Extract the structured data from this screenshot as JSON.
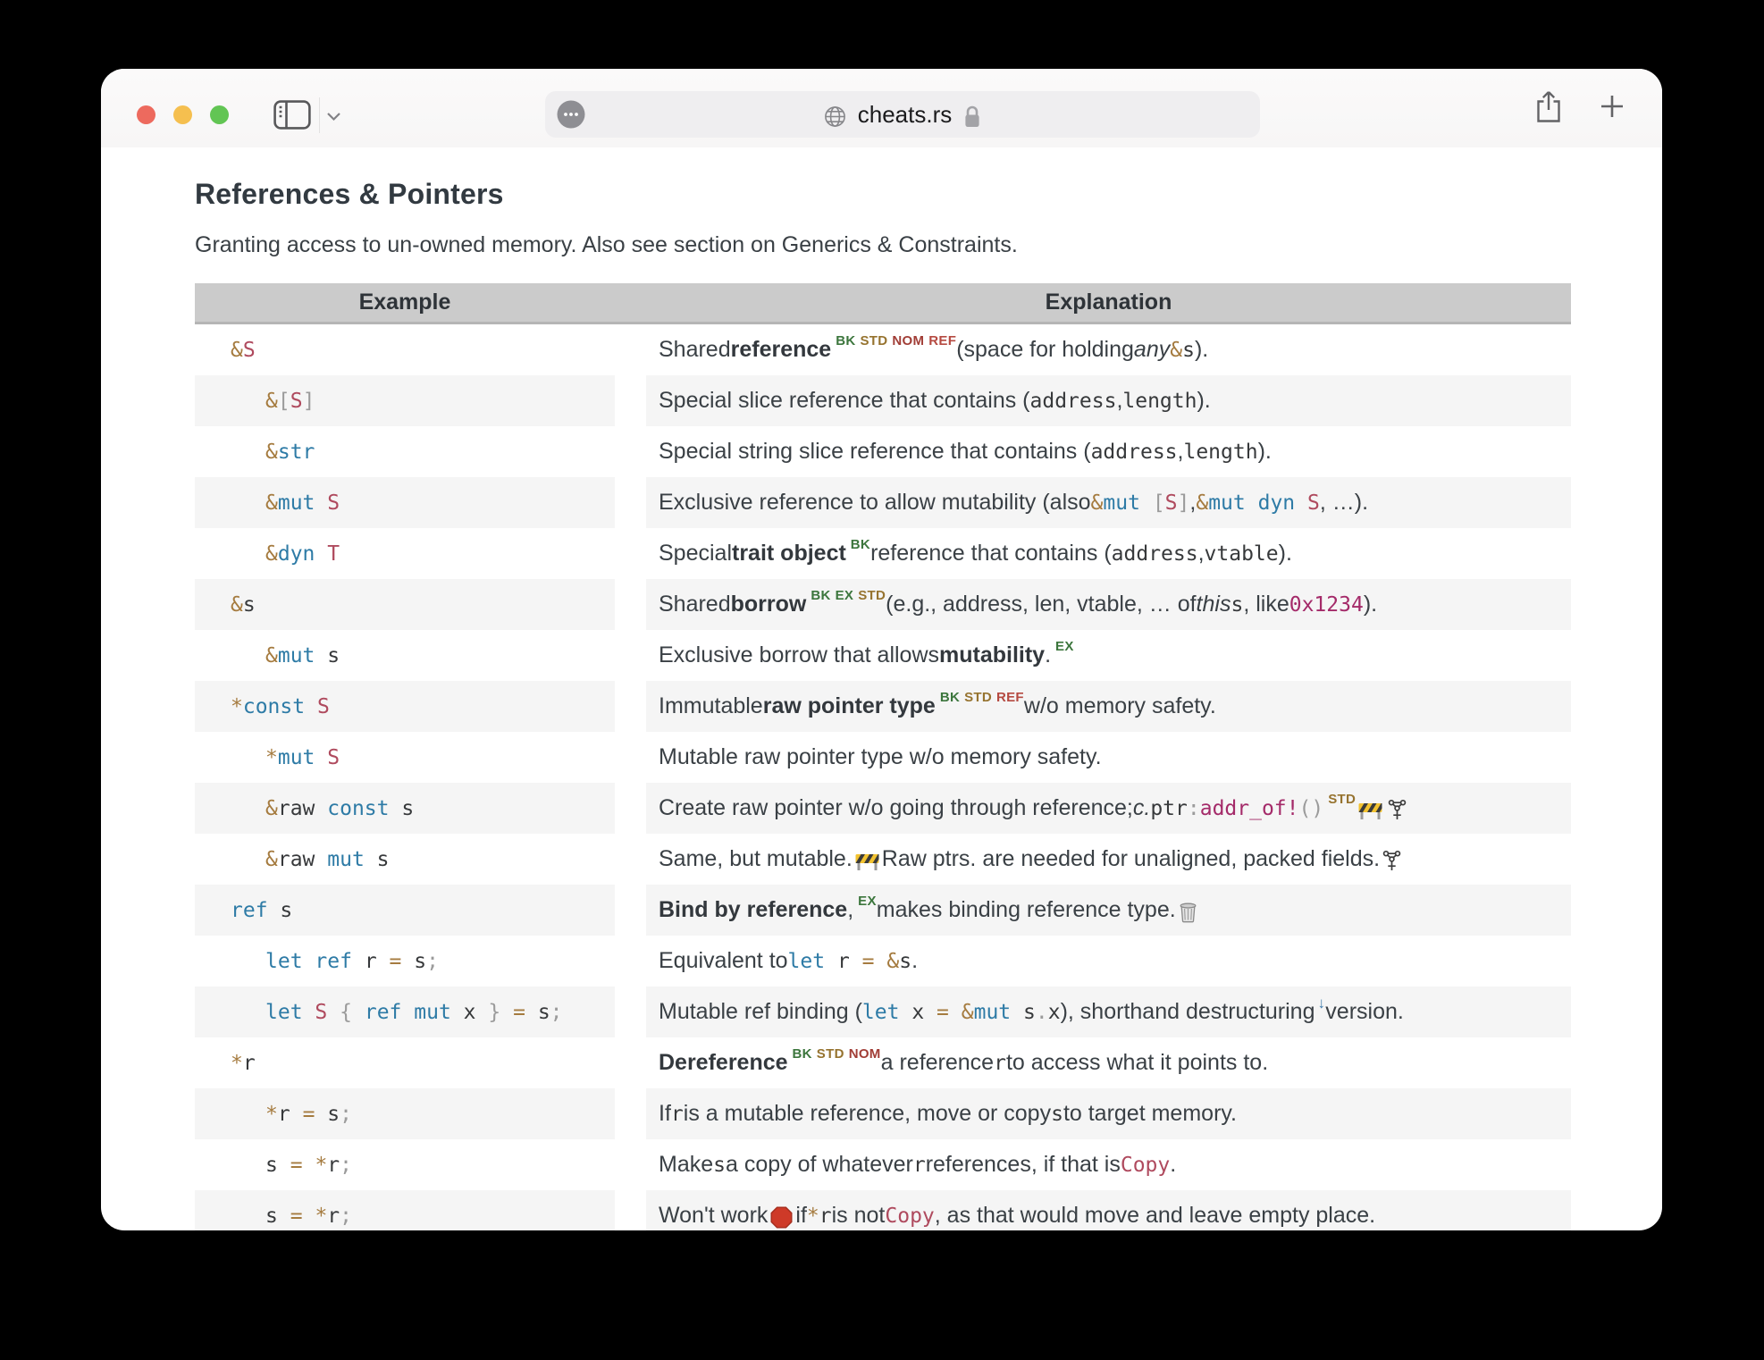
{
  "browser": {
    "url": "cheats.rs",
    "traffic_lights": {
      "close": "#ed6a5e",
      "minimize": "#f5bf4f",
      "zoom": "#62c554"
    },
    "icons": [
      "sidebar-toggle-icon",
      "chevron-down-icon",
      "globe-icon",
      "lock-icon",
      "page-settings-icon",
      "share-icon",
      "new-tab-icon"
    ]
  },
  "colors": {
    "header_bg": "#cbcbcb",
    "row_alt_bg": "#f5f5f5",
    "code_operator": "#a57b3f",
    "code_keyword": "#2e7ba6",
    "code_type": "#af4a5e",
    "code_macro": "#a42a69",
    "code_punct": "#9b9b9b",
    "sup_book_green": "#3c763d",
    "sup_std_gold": "#96732f",
    "sup_nom_red": "#a13d36",
    "sup_ref_red": "#b54a41"
  },
  "page": {
    "title": "References & Pointers",
    "subtitle": "Granting access to un-owned memory. Also see section on Generics & Constraints.",
    "table": {
      "headers": [
        "Example",
        "Explanation"
      ],
      "rows": [
        {
          "indent": 0,
          "code": [
            [
              "&",
              "o"
            ],
            [
              "S",
              "y"
            ]
          ],
          "expl": [
            [
              "Shared ",
              "p"
            ],
            [
              "reference",
              "b"
            ],
            [
              "BK",
              "sb"
            ],
            [
              "STD",
              "ss"
            ],
            [
              "NOM",
              "sn"
            ],
            [
              "REF",
              "sr"
            ],
            [
              " (space for holding ",
              "p"
            ],
            [
              "any",
              "i"
            ],
            [
              " ",
              "p"
            ],
            [
              "&",
              "o"
            ],
            [
              "s",
              "c"
            ],
            [
              ").",
              "p"
            ]
          ]
        },
        {
          "indent": 1,
          "code": [
            [
              "&",
              "o"
            ],
            [
              "[",
              "u"
            ],
            [
              "S",
              "y"
            ],
            [
              "]",
              "u"
            ]
          ],
          "expl": [
            [
              "Special slice reference that contains (",
              "p"
            ],
            [
              "address",
              "c"
            ],
            [
              ", ",
              "p"
            ],
            [
              "length",
              "c"
            ],
            [
              ").",
              "p"
            ]
          ]
        },
        {
          "indent": 1,
          "code": [
            [
              "&",
              "o"
            ],
            [
              "str",
              "k"
            ]
          ],
          "expl": [
            [
              "Special string slice reference that contains (",
              "p"
            ],
            [
              "address",
              "c"
            ],
            [
              ", ",
              "p"
            ],
            [
              "length",
              "c"
            ],
            [
              ").",
              "p"
            ]
          ]
        },
        {
          "indent": 1,
          "code": [
            [
              "&",
              "o"
            ],
            [
              "mut",
              "k"
            ],
            [
              " ",
              "c"
            ],
            [
              "S",
              "y"
            ]
          ],
          "expl": [
            [
              "Exclusive reference to allow mutability (also ",
              "p"
            ],
            [
              "&",
              "o"
            ],
            [
              "mut",
              "k"
            ],
            [
              " ",
              "c"
            ],
            [
              "[",
              "u"
            ],
            [
              "S",
              "y"
            ],
            [
              "]",
              "u"
            ],
            [
              ", ",
              "p"
            ],
            [
              "&",
              "o"
            ],
            [
              "mut",
              "k"
            ],
            [
              " ",
              "c"
            ],
            [
              "dyn",
              "k"
            ],
            [
              " ",
              "c"
            ],
            [
              "S",
              "y"
            ],
            [
              ", …).",
              "p"
            ]
          ]
        },
        {
          "indent": 1,
          "code": [
            [
              "&",
              "o"
            ],
            [
              "dyn",
              "k"
            ],
            [
              " ",
              "c"
            ],
            [
              "T",
              "y"
            ]
          ],
          "expl": [
            [
              "Special ",
              "p"
            ],
            [
              "trait object",
              "b"
            ],
            [
              "BK",
              "sb"
            ],
            [
              " reference that contains (",
              "p"
            ],
            [
              "address",
              "c"
            ],
            [
              ", ",
              "p"
            ],
            [
              "vtable",
              "c"
            ],
            [
              ").",
              "p"
            ]
          ]
        },
        {
          "indent": 0,
          "code": [
            [
              "&",
              "o"
            ],
            [
              "s",
              "c"
            ]
          ],
          "expl": [
            [
              "Shared ",
              "p"
            ],
            [
              "borrow",
              "b"
            ],
            [
              "BK",
              "sb"
            ],
            [
              "EX",
              "se"
            ],
            [
              "STD",
              "ss"
            ],
            [
              " (e.g., address, len, vtable, … of ",
              "p"
            ],
            [
              "this",
              "i"
            ],
            [
              " ",
              "p"
            ],
            [
              "s",
              "c"
            ],
            [
              ", like ",
              "p"
            ],
            [
              "0x1234",
              "m"
            ],
            [
              ").",
              "p"
            ]
          ]
        },
        {
          "indent": 1,
          "code": [
            [
              "&",
              "o"
            ],
            [
              "mut",
              "k"
            ],
            [
              " ",
              "c"
            ],
            [
              "s",
              "c"
            ]
          ],
          "expl": [
            [
              "Exclusive borrow that allows ",
              "p"
            ],
            [
              "mutability",
              "b"
            ],
            [
              ".",
              "p"
            ],
            [
              "EX",
              "se"
            ]
          ]
        },
        {
          "indent": 0,
          "code": [
            [
              "*",
              "o"
            ],
            [
              "const",
              "k"
            ],
            [
              " ",
              "c"
            ],
            [
              "S",
              "y"
            ]
          ],
          "expl": [
            [
              "Immutable ",
              "p"
            ],
            [
              "raw pointer type",
              "b"
            ],
            [
              "BK",
              "sb"
            ],
            [
              "STD",
              "ss"
            ],
            [
              "REF",
              "sr"
            ],
            [
              " w/o memory safety.",
              "p"
            ]
          ]
        },
        {
          "indent": 1,
          "code": [
            [
              "*",
              "o"
            ],
            [
              "mut",
              "k"
            ],
            [
              " ",
              "c"
            ],
            [
              "S",
              "y"
            ]
          ],
          "expl": [
            [
              "Mutable raw pointer type w/o memory safety.",
              "p"
            ]
          ]
        },
        {
          "indent": 1,
          "code": [
            [
              "&",
              "o"
            ],
            [
              "raw",
              "c"
            ],
            [
              " ",
              "c"
            ],
            [
              "const",
              "k"
            ],
            [
              " ",
              "c"
            ],
            [
              "s",
              "c"
            ]
          ],
          "expl": [
            [
              "Create raw pointer w/o going through reference; ",
              "p"
            ],
            [
              "c.",
              "i"
            ],
            [
              " ",
              "p"
            ],
            [
              "ptr",
              "c"
            ],
            [
              ":",
              "u"
            ],
            [
              "addr_of!",
              "m"
            ],
            [
              "()",
              "u"
            ],
            [
              " ",
              "p"
            ],
            [
              "STD",
              "ss"
            ],
            [
              "  ",
              "p"
            ],
            [
              "",
              "ic:construction"
            ],
            [
              " ",
              "p"
            ],
            [
              "",
              "ic:staff"
            ]
          ]
        },
        {
          "indent": 1,
          "code": [
            [
              "&",
              "o"
            ],
            [
              "raw",
              "c"
            ],
            [
              " ",
              "c"
            ],
            [
              "mut",
              "k"
            ],
            [
              " ",
              "c"
            ],
            [
              "s",
              "c"
            ]
          ],
          "expl": [
            [
              "Same, but mutable. ",
              "p"
            ],
            [
              "",
              "ic:construction"
            ],
            [
              " Raw ptrs. are needed for unaligned, packed fields. ",
              "p"
            ],
            [
              "",
              "ic:staff"
            ]
          ]
        },
        {
          "indent": 0,
          "code": [
            [
              "ref",
              "k"
            ],
            [
              " ",
              "c"
            ],
            [
              "s",
              "c"
            ]
          ],
          "expl": [
            [
              "Bind by reference",
              "b"
            ],
            [
              ", ",
              "p"
            ],
            [
              "EX",
              "se"
            ],
            [
              " makes binding reference type. ",
              "p"
            ],
            [
              "",
              "ic:trash"
            ]
          ]
        },
        {
          "indent": 1,
          "code": [
            [
              "let",
              "k"
            ],
            [
              " ",
              "c"
            ],
            [
              "ref",
              "k"
            ],
            [
              " ",
              "c"
            ],
            [
              "r",
              "c"
            ],
            [
              " ",
              "c"
            ],
            [
              "=",
              "o"
            ],
            [
              " ",
              "c"
            ],
            [
              "s",
              "c"
            ],
            [
              ";",
              "u"
            ]
          ],
          "expl": [
            [
              "Equivalent to ",
              "p"
            ],
            [
              "let",
              "k"
            ],
            [
              " ",
              "c"
            ],
            [
              "r",
              "c"
            ],
            [
              " ",
              "c"
            ],
            [
              "=",
              "o"
            ],
            [
              " ",
              "c"
            ],
            [
              "&",
              "o"
            ],
            [
              "s",
              "c"
            ],
            [
              ".",
              "p"
            ]
          ]
        },
        {
          "indent": 1,
          "code": [
            [
              "let",
              "k"
            ],
            [
              " ",
              "c"
            ],
            [
              "S",
              "y"
            ],
            [
              " ",
              "c"
            ],
            [
              "{",
              "u"
            ],
            [
              " ",
              "c"
            ],
            [
              "ref",
              "k"
            ],
            [
              " ",
              "c"
            ],
            [
              "mut",
              "k"
            ],
            [
              " ",
              "c"
            ],
            [
              "x",
              "c"
            ],
            [
              " ",
              "c"
            ],
            [
              "}",
              "u"
            ],
            [
              " ",
              "c"
            ],
            [
              "=",
              "o"
            ],
            [
              " ",
              "c"
            ],
            [
              "s",
              "c"
            ],
            [
              ";",
              "u"
            ]
          ],
          "expl": [
            [
              "Mutable ref binding (",
              "p"
            ],
            [
              "let",
              "k"
            ],
            [
              " ",
              "c"
            ],
            [
              "x",
              "c"
            ],
            [
              " ",
              "c"
            ],
            [
              "=",
              "o"
            ],
            [
              " ",
              "c"
            ],
            [
              "&",
              "o"
            ],
            [
              "mut",
              "k"
            ],
            [
              " ",
              "c"
            ],
            [
              "s",
              "c"
            ],
            [
              ".",
              "u"
            ],
            [
              "x",
              "c"
            ],
            [
              "), shorthand destructuring ",
              "p"
            ],
            [
              "↓",
              "sa"
            ],
            [
              " version.",
              "p"
            ]
          ]
        },
        {
          "indent": 0,
          "code": [
            [
              "*",
              "o"
            ],
            [
              "r",
              "c"
            ]
          ],
          "expl": [
            [
              "Dereference",
              "b"
            ],
            [
              "BK",
              "sb"
            ],
            [
              "STD",
              "ss"
            ],
            [
              "NOM",
              "sn"
            ],
            [
              " a reference ",
              "p"
            ],
            [
              "r",
              "c"
            ],
            [
              " to access what it points to.",
              "p"
            ]
          ]
        },
        {
          "indent": 1,
          "code": [
            [
              "*",
              "o"
            ],
            [
              "r",
              "c"
            ],
            [
              " ",
              "c"
            ],
            [
              "=",
              "o"
            ],
            [
              " ",
              "c"
            ],
            [
              "s",
              "c"
            ],
            [
              ";",
              "u"
            ]
          ],
          "expl": [
            [
              "If ",
              "p"
            ],
            [
              "r",
              "c"
            ],
            [
              " is a mutable reference, move or copy ",
              "p"
            ],
            [
              "s",
              "c"
            ],
            [
              " to target memory.",
              "p"
            ]
          ]
        },
        {
          "indent": 1,
          "code": [
            [
              "s",
              "c"
            ],
            [
              " ",
              "c"
            ],
            [
              "=",
              "o"
            ],
            [
              " ",
              "c"
            ],
            [
              "*",
              "o"
            ],
            [
              "r",
              "c"
            ],
            [
              ";",
              "u"
            ]
          ],
          "expl": [
            [
              "Make ",
              "p"
            ],
            [
              "s",
              "c"
            ],
            [
              " a copy of whatever ",
              "p"
            ],
            [
              "r",
              "c"
            ],
            [
              " references, if that is ",
              "p"
            ],
            [
              "Copy",
              "y"
            ],
            [
              ".",
              "p"
            ]
          ]
        },
        {
          "indent": 1,
          "code": [
            [
              "s",
              "c"
            ],
            [
              " ",
              "c"
            ],
            [
              "=",
              "o"
            ],
            [
              " ",
              "c"
            ],
            [
              "*",
              "o"
            ],
            [
              "r",
              "c"
            ],
            [
              ";",
              "u"
            ]
          ],
          "expl": [
            [
              "Won't work ",
              "p"
            ],
            [
              "",
              "ic:stop"
            ],
            [
              " if ",
              "p"
            ],
            [
              "*",
              "o"
            ],
            [
              "r",
              "c"
            ],
            [
              " is not ",
              "p"
            ],
            [
              "Copy",
              "y"
            ],
            [
              ", as that would move and leave empty place.",
              "p"
            ]
          ]
        }
      ]
    }
  }
}
